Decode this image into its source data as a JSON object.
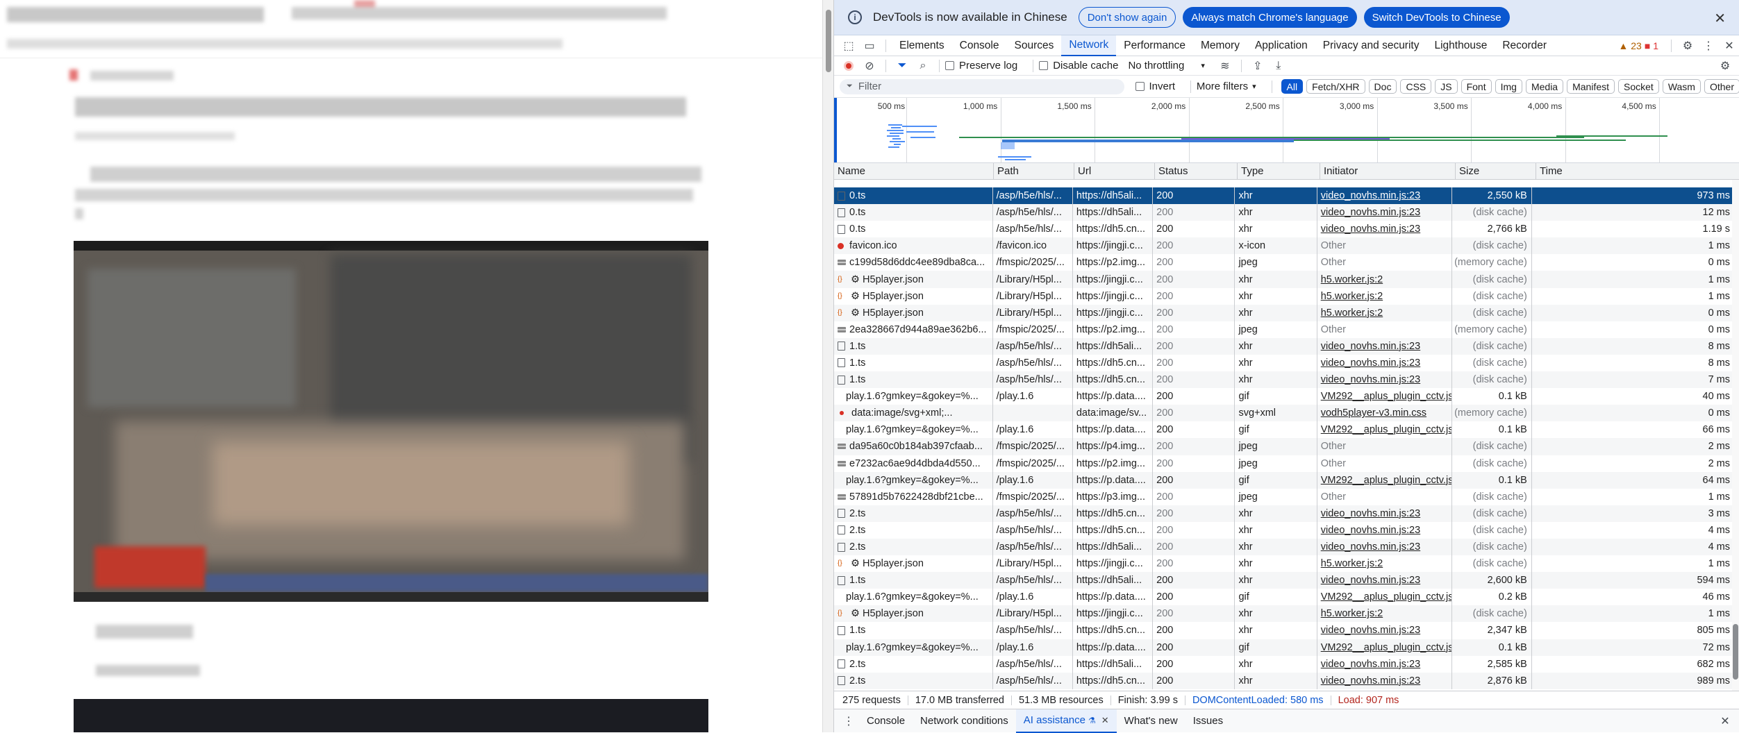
{
  "infobar": {
    "message": "DevTools is now available in Chinese",
    "dont_show": "Don't show again",
    "always_match": "Always match Chrome's language",
    "switch": "Switch DevTools to Chinese"
  },
  "tabs": [
    "Elements",
    "Console",
    "Sources",
    "Network",
    "Performance",
    "Memory",
    "Application",
    "Privacy and security",
    "Lighthouse",
    "Recorder"
  ],
  "active_tab": "Network",
  "counts": {
    "warnings": "23",
    "errors": "1"
  },
  "toolbar": {
    "preserve_log": "Preserve log",
    "disable_cache": "Disable cache",
    "throttling": "No throttling"
  },
  "filterbar": {
    "placeholder": "Filter",
    "invert": "Invert",
    "more_filters": "More filters",
    "chips": [
      "All",
      "Fetch/XHR",
      "Doc",
      "CSS",
      "JS",
      "Font",
      "Img",
      "Media",
      "Manifest",
      "Socket",
      "Wasm",
      "Other"
    ]
  },
  "overview_ticks": [
    "500 ms",
    "1,000 ms",
    "1,500 ms",
    "2,000 ms",
    "2,500 ms",
    "3,000 ms",
    "3,500 ms",
    "4,000 ms",
    "4,500 ms"
  ],
  "columns": {
    "name": "Name",
    "path": "Path",
    "url": "Url",
    "status": "Status",
    "type": "Type",
    "initiator": "Initiator",
    "size": "Size",
    "time": "Time"
  },
  "rows": [
    {
      "icon": "doc",
      "name": "0.ts",
      "path": "/asp/h5e/hls/...",
      "url": "https://dh5ali...",
      "status": "200",
      "type": "xhr",
      "initiator": "video_novhs.min.js:23",
      "init_link": true,
      "size": "2,550 kB",
      "time": "973 ms",
      "sel": true
    },
    {
      "icon": "doc",
      "name": "0.ts",
      "path": "/asp/h5e/hls/...",
      "url": "https://dh5ali...",
      "status": "200",
      "type": "xhr",
      "initiator": "video_novhs.min.js:23",
      "init_link": true,
      "size": "(disk cache)",
      "time": "12 ms"
    },
    {
      "icon": "doc",
      "name": "0.ts",
      "path": "/asp/h5e/hls/...",
      "url": "https://dh5.cn...",
      "status": "200",
      "type": "xhr",
      "initiator": "video_novhs.min.js:23",
      "init_link": true,
      "size": "2,766 kB",
      "time": "1.19 s"
    },
    {
      "icon": "fav",
      "name": "favicon.ico",
      "path": "/favicon.ico",
      "url": "https://jingji.c...",
      "status": "200",
      "type": "x-icon",
      "initiator": "Other",
      "init_link": false,
      "size": "(disk cache)",
      "time": "1 ms"
    },
    {
      "icon": "img",
      "name": "c199d58d6ddc4ee89dba8ca...",
      "path": "/fmspic/2025/...",
      "url": "https://p2.img...",
      "status": "200",
      "type": "jpeg",
      "initiator": "Other",
      "init_link": false,
      "size": "(memory cache)",
      "time": "0 ms"
    },
    {
      "icon": "json",
      "name": "⚙ H5player.json",
      "path": "/Library/H5pl...",
      "url": "https://jingji.c...",
      "status": "200",
      "type": "xhr",
      "initiator": "h5.worker.js:2",
      "init_link": true,
      "size": "(disk cache)",
      "time": "1 ms"
    },
    {
      "icon": "json",
      "name": "⚙ H5player.json",
      "path": "/Library/H5pl...",
      "url": "https://jingji.c...",
      "status": "200",
      "type": "xhr",
      "initiator": "h5.worker.js:2",
      "init_link": true,
      "size": "(disk cache)",
      "time": "1 ms"
    },
    {
      "icon": "json",
      "name": "⚙ H5player.json",
      "path": "/Library/H5pl...",
      "url": "https://jingji.c...",
      "status": "200",
      "type": "xhr",
      "initiator": "h5.worker.js:2",
      "init_link": true,
      "size": "(disk cache)",
      "time": "0 ms"
    },
    {
      "icon": "img",
      "name": "2ea328667d944a89ae362b6...",
      "path": "/fmspic/2025/...",
      "url": "https://p2.img...",
      "status": "200",
      "type": "jpeg",
      "initiator": "Other",
      "init_link": false,
      "size": "(memory cache)",
      "time": "0 ms"
    },
    {
      "icon": "doc",
      "name": "1.ts",
      "path": "/asp/h5e/hls/...",
      "url": "https://dh5ali...",
      "status": "200",
      "type": "xhr",
      "initiator": "video_novhs.min.js:23",
      "init_link": true,
      "size": "(disk cache)",
      "time": "8 ms"
    },
    {
      "icon": "doc",
      "name": "1.ts",
      "path": "/asp/h5e/hls/...",
      "url": "https://dh5.cn...",
      "status": "200",
      "type": "xhr",
      "initiator": "video_novhs.min.js:23",
      "init_link": true,
      "size": "(disk cache)",
      "time": "8 ms"
    },
    {
      "icon": "doc",
      "name": "1.ts",
      "path": "/asp/h5e/hls/...",
      "url": "https://dh5.cn...",
      "status": "200",
      "type": "xhr",
      "initiator": "video_novhs.min.js:23",
      "init_link": true,
      "size": "(disk cache)",
      "time": "7 ms"
    },
    {
      "icon": "none",
      "name": "play.1.6?gmkey=&gokey=%...",
      "path": "/play.1.6",
      "url": "https://p.data....",
      "status": "200",
      "type": "gif",
      "initiator": "VM292__aplus_plugin_cctv.js",
      "init_link": true,
      "size": "0.1 kB",
      "time": "40 ms"
    },
    {
      "icon": "svgdot",
      "name": "data:image/svg+xml;...",
      "path": "",
      "url": "data:image/sv...",
      "status": "200",
      "type": "svg+xml",
      "initiator": "vodh5player-v3.min.css",
      "init_link": true,
      "size": "(memory cache)",
      "time": "0 ms"
    },
    {
      "icon": "none",
      "name": "play.1.6?gmkey=&gokey=%...",
      "path": "/play.1.6",
      "url": "https://p.data....",
      "status": "200",
      "type": "gif",
      "initiator": "VM292__aplus_plugin_cctv.js",
      "init_link": true,
      "size": "0.1 kB",
      "time": "66 ms"
    },
    {
      "icon": "img",
      "name": "da95a60c0b184ab397cfaab...",
      "path": "/fmspic/2025/...",
      "url": "https://p4.img...",
      "status": "200",
      "type": "jpeg",
      "initiator": "Other",
      "init_link": false,
      "size": "(disk cache)",
      "time": "2 ms"
    },
    {
      "icon": "img",
      "name": "e7232ac6ae9d4dbda4d550...",
      "path": "/fmspic/2025/...",
      "url": "https://p2.img...",
      "status": "200",
      "type": "jpeg",
      "initiator": "Other",
      "init_link": false,
      "size": "(disk cache)",
      "time": "2 ms"
    },
    {
      "icon": "none",
      "name": "play.1.6?gmkey=&gokey=%...",
      "path": "/play.1.6",
      "url": "https://p.data....",
      "status": "200",
      "type": "gif",
      "initiator": "VM292__aplus_plugin_cctv.js",
      "init_link": true,
      "size": "0.1 kB",
      "time": "64 ms"
    },
    {
      "icon": "img",
      "name": "57891d5b7622428dbf21cbe...",
      "path": "/fmspic/2025/...",
      "url": "https://p3.img...",
      "status": "200",
      "type": "jpeg",
      "initiator": "Other",
      "init_link": false,
      "size": "(disk cache)",
      "time": "1 ms"
    },
    {
      "icon": "doc",
      "name": "2.ts",
      "path": "/asp/h5e/hls/...",
      "url": "https://dh5.cn...",
      "status": "200",
      "type": "xhr",
      "initiator": "video_novhs.min.js:23",
      "init_link": true,
      "size": "(disk cache)",
      "time": "3 ms"
    },
    {
      "icon": "doc",
      "name": "2.ts",
      "path": "/asp/h5e/hls/...",
      "url": "https://dh5.cn...",
      "status": "200",
      "type": "xhr",
      "initiator": "video_novhs.min.js:23",
      "init_link": true,
      "size": "(disk cache)",
      "time": "4 ms"
    },
    {
      "icon": "doc",
      "name": "2.ts",
      "path": "/asp/h5e/hls/...",
      "url": "https://dh5ali...",
      "status": "200",
      "type": "xhr",
      "initiator": "video_novhs.min.js:23",
      "init_link": true,
      "size": "(disk cache)",
      "time": "4 ms"
    },
    {
      "icon": "json",
      "name": "⚙ H5player.json",
      "path": "/Library/H5pl...",
      "url": "https://jingji.c...",
      "status": "200",
      "type": "xhr",
      "initiator": "h5.worker.js:2",
      "init_link": true,
      "size": "(disk cache)",
      "time": "1 ms"
    },
    {
      "icon": "doc",
      "name": "1.ts",
      "path": "/asp/h5e/hls/...",
      "url": "https://dh5ali...",
      "status": "200",
      "type": "xhr",
      "initiator": "video_novhs.min.js:23",
      "init_link": true,
      "size": "2,600 kB",
      "time": "594 ms"
    },
    {
      "icon": "none",
      "name": "play.1.6?gmkey=&gokey=%...",
      "path": "/play.1.6",
      "url": "https://p.data....",
      "status": "200",
      "type": "gif",
      "initiator": "VM292__aplus_plugin_cctv.js",
      "init_link": true,
      "size": "0.2 kB",
      "time": "46 ms"
    },
    {
      "icon": "json",
      "name": "⚙ H5player.json",
      "path": "/Library/H5pl...",
      "url": "https://jingji.c...",
      "status": "200",
      "type": "xhr",
      "initiator": "h5.worker.js:2",
      "init_link": true,
      "size": "(disk cache)",
      "time": "1 ms"
    },
    {
      "icon": "doc",
      "name": "1.ts",
      "path": "/asp/h5e/hls/...",
      "url": "https://dh5.cn...",
      "status": "200",
      "type": "xhr",
      "initiator": "video_novhs.min.js:23",
      "init_link": true,
      "size": "2,347 kB",
      "time": "805 ms"
    },
    {
      "icon": "none",
      "name": "play.1.6?gmkey=&gokey=%...",
      "path": "/play.1.6",
      "url": "https://p.data....",
      "status": "200",
      "type": "gif",
      "initiator": "VM292__aplus_plugin_cctv.js",
      "init_link": true,
      "size": "0.1 kB",
      "time": "72 ms"
    },
    {
      "icon": "doc",
      "name": "2.ts",
      "path": "/asp/h5e/hls/...",
      "url": "https://dh5ali...",
      "status": "200",
      "type": "xhr",
      "initiator": "video_novhs.min.js:23",
      "init_link": true,
      "size": "2,585 kB",
      "time": "682 ms"
    },
    {
      "icon": "doc",
      "name": "2.ts",
      "path": "/asp/h5e/hls/...",
      "url": "https://dh5.cn...",
      "status": "200",
      "type": "xhr",
      "initiator": "video_novhs.min.js:23",
      "init_link": true,
      "size": "2,876 kB",
      "time": "989 ms"
    }
  ],
  "statusbar": {
    "requests": "275 requests",
    "transferred": "17.0 MB transferred",
    "resources": "51.3 MB resources",
    "finish": "Finish: 3.99 s",
    "domcontentloaded": "DOMContentLoaded: 580 ms",
    "load": "Load: 907 ms"
  },
  "drawer": {
    "tabs": [
      "Console",
      "Network conditions",
      "AI assistance",
      "What's new",
      "Issues"
    ],
    "active": "AI assistance"
  }
}
